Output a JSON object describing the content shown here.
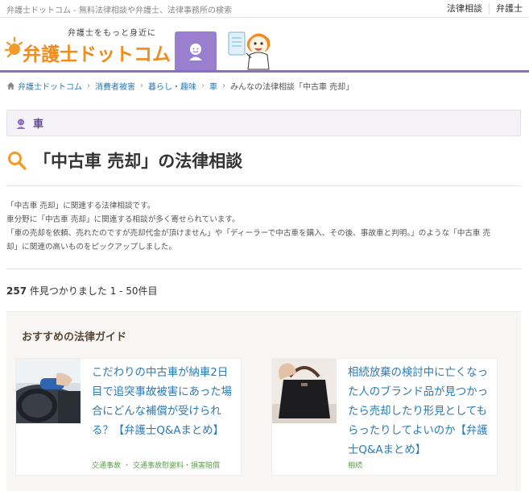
{
  "topbar": {
    "tagline": "弁護士ドットコム - 無料法律相談や弁護士、法律事務所の検索",
    "links": [
      "法律相談",
      "弁護士"
    ]
  },
  "header": {
    "catchphrase": "弁護士をもっと身近に",
    "logo_text": "弁護士ドットコム",
    "accent": "#8a6ec4",
    "brand_color": "#f08c1c"
  },
  "breadcrumb": {
    "items": [
      "弁護士ドットコム",
      "消費者被害",
      "暮らし・趣味",
      "車",
      "みんなの法律相談「中古車 売却」"
    ]
  },
  "category": {
    "label": "車"
  },
  "page": {
    "title": "「中古車 売却」の法律相談",
    "intro": [
      "「中古車 売却」に関連する法律相談です。",
      "車分野に「中古車 売却」に関連する相談が多く寄せられています。",
      "「車の売却を依頼、売れたのですが売却代金が頂けません」や「ディーラーで中古車を購入、その後、事故車と判明。」のような「中古車 売",
      "却」に関連の高いものをピックアップしました。"
    ],
    "count_number": "257",
    "count_text": " 件見つかりました 1 - 50件目"
  },
  "guide": {
    "heading": "おすすめの法律ガイド",
    "cards": [
      {
        "title": "こだわりの中古車が納車2日目で追突事故被害にあった場合にどんな補償が受けられる？【弁護士Q&Aまとめ】",
        "tags": [
          "交通事故",
          "交通事故慰謝料・損害賠償"
        ]
      },
      {
        "title": "相続放棄の検討中に亡くなった人のブランド品が見つかったら売却したり形見としてもらったりしてよいのか【弁護士Q&Aまとめ】",
        "tags": [
          "相続"
        ]
      }
    ]
  }
}
